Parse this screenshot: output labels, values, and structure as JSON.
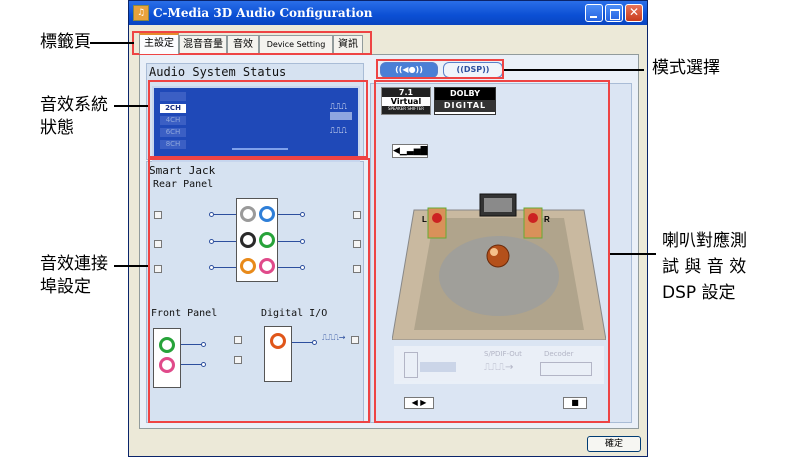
{
  "window": {
    "title": "C-Media 3D Audio Configuration",
    "ok_label": "確定"
  },
  "tabs": [
    {
      "label": "主設定",
      "active": true
    },
    {
      "label": "混音音量",
      "active": false
    },
    {
      "label": "音效",
      "active": false
    },
    {
      "label": "Device Setting",
      "active": false
    },
    {
      "label": "資訊",
      "active": false
    }
  ],
  "audio_status": {
    "title": "Audio System Status",
    "channels": [
      "2CH",
      "4CH",
      "6CH",
      "8CH"
    ],
    "active_channel": "2CH",
    "signal_icons": [
      "digital-wave-icon",
      "analog-wave-icon"
    ]
  },
  "smart_jack": {
    "title": "Smart Jack",
    "rear_panel_label": "Rear Panel",
    "front_panel_label": "Front Panel",
    "digital_io_label": "Digital I/O",
    "jack_colors": {
      "green": "#27a33a",
      "blue": "#2f7fd8",
      "black": "#2a2a2a",
      "orange": "#e88a1a",
      "pink": "#e04a8a"
    }
  },
  "mode": {
    "speaker_mode_label": "(( )) ",
    "dsp_label": "((DSP))"
  },
  "dsp_badges": [
    {
      "line1": "7.1",
      "line2": "Virtual",
      "line3": "SPEAKER SHIFTER"
    },
    {
      "line1": "DOLBY",
      "line2": "DIGITAL"
    }
  ],
  "spdif": {
    "source_label": "S/PDIF-Out",
    "decoder_label": "Decoder"
  },
  "annotations": {
    "tab_page": "標籤頁",
    "audio_status": [
      "音效系統",
      "狀態"
    ],
    "connector_setting": [
      "音效連接",
      "埠設定"
    ],
    "mode_select": "模式選擇",
    "speaker_test": [
      "喇叭對應測",
      "試 與 音 效",
      "DSP 設定"
    ]
  },
  "colors": {
    "highlight_red": "#e44444",
    "titlebar_blue": "#0b4fd4",
    "status_blue": "#1f49b8"
  }
}
